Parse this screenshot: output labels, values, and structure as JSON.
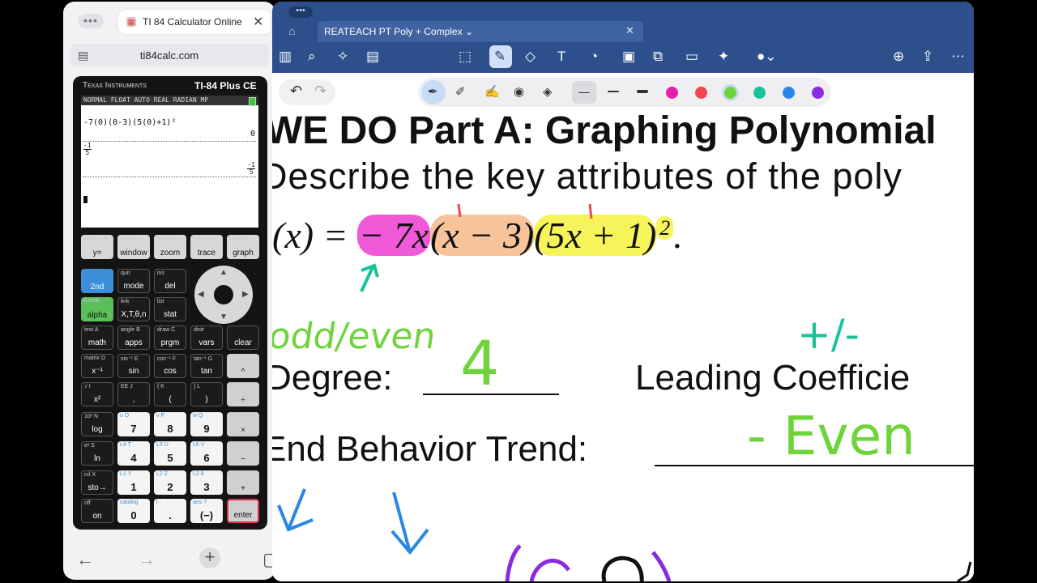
{
  "browser": {
    "tab_title": "TI 84 Calculator Online",
    "url": "ti84calc.com",
    "dots": "•••",
    "close": "✕"
  },
  "calculator": {
    "brand": "Texas Instruments",
    "model": "TI-84 Plus CE",
    "status": "NORMAL FLOAT AUTO REAL RADIAN MP",
    "expression": "-7(0)(0-3)(5(0)+1)²",
    "result1": "0",
    "entry2_num": "-1",
    "entry2_den": "5",
    "result2_num": "-1",
    "result2_den": "5",
    "keys": [
      {
        "top": "statplot f1",
        "label": "y="
      },
      {
        "top": "tblset f2",
        "label": "window"
      },
      {
        "top": "format f3",
        "label": "zoom"
      },
      {
        "top": "calc f4",
        "label": "trace"
      },
      {
        "top": "table f5",
        "label": "graph"
      },
      {
        "top": "",
        "label": "2nd"
      },
      {
        "top": "quit",
        "label": "mode"
      },
      {
        "top": "ins",
        "label": "del"
      },
      {
        "top": "A-lock",
        "label": "alpha"
      },
      {
        "top": "link",
        "label": "X,T,θ,n"
      },
      {
        "top": "list",
        "label": "stat"
      },
      {
        "top": "test A",
        "label": "math"
      },
      {
        "top": "angle B",
        "label": "apps"
      },
      {
        "top": "draw C",
        "label": "prgm"
      },
      {
        "top": "distr",
        "label": "vars"
      },
      {
        "top": "",
        "label": "clear"
      },
      {
        "top": "matrix D",
        "label": "x⁻¹"
      },
      {
        "top": "sin⁻¹ E",
        "label": "sin"
      },
      {
        "top": "cos⁻¹ F",
        "label": "cos"
      },
      {
        "top": "tan⁻¹ G",
        "label": "tan"
      },
      {
        "top": "π H",
        "label": "^"
      },
      {
        "top": "√ I",
        "label": "x²"
      },
      {
        "top": "EE J",
        "label": ","
      },
      {
        "top": "{ K",
        "label": "("
      },
      {
        "top": "} L",
        "label": ")"
      },
      {
        "top": "e M",
        "label": "÷"
      },
      {
        "top": "10ˣ N",
        "label": "log"
      },
      {
        "top": "u O",
        "label": "7"
      },
      {
        "top": "v P",
        "label": "8"
      },
      {
        "top": "w Q",
        "label": "9"
      },
      {
        "top": "[ R",
        "label": "×"
      },
      {
        "top": "eˣ S",
        "label": "ln"
      },
      {
        "top": "L4 T",
        "label": "4"
      },
      {
        "top": "L5 U",
        "label": "5"
      },
      {
        "top": "L6 V",
        "label": "6"
      },
      {
        "top": "] W",
        "label": "−"
      },
      {
        "top": "rcl X",
        "label": "sto→"
      },
      {
        "top": "L1 Y",
        "label": "1"
      },
      {
        "top": "L2 Z",
        "label": "2"
      },
      {
        "top": "L3 θ",
        "label": "3"
      },
      {
        "top": "mem \"",
        "label": "+"
      },
      {
        "top": "off",
        "label": "on"
      },
      {
        "top": "catalog",
        "label": "0"
      },
      {
        "top": "i :",
        "label": "."
      },
      {
        "top": "ans ?",
        "label": "(−)"
      },
      {
        "top": "entry solve",
        "label": "enter"
      }
    ]
  },
  "notes": {
    "tab_title": "REATEACH PT Poly + Complex",
    "title": "WE DO Part A:  Graphing Polynomial",
    "prompt": "Describe the key attributes of the poly",
    "equation_lhs": "(x) =",
    "eq_term1": "− 7x",
    "eq_term2": "(x − 3)",
    "eq_term3": "(5x + 1)",
    "eq_exponent": "2",
    "eq_end": ".",
    "degree_label": "Degree:",
    "leading_label": "Leading Coefficie",
    "end_label": "End Behavior Trend:",
    "ink": {
      "odd_even": "odd/even",
      "four": "4",
      "plus_minus": "+/-",
      "minus_even": "- Even"
    },
    "colors": {
      "pink": "#e61fa8",
      "red": "#f2474f",
      "green": "#6fd43c",
      "teal": "#19c29a",
      "blue": "#2a86e8",
      "purple": "#8a2be2"
    }
  }
}
